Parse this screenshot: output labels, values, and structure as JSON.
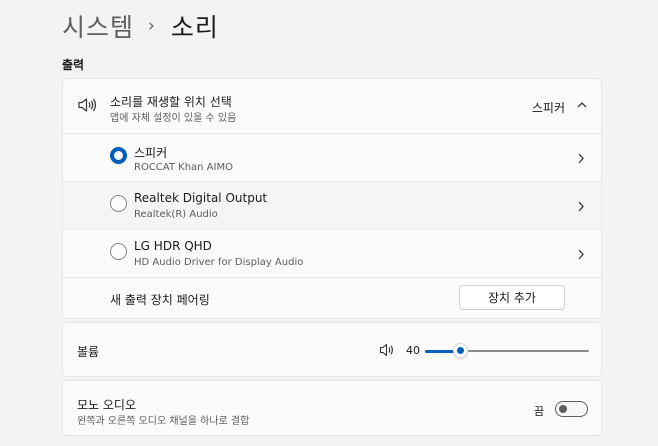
{
  "breadcrumb": {
    "parent": "시스템",
    "separator": "›",
    "current": "소리"
  },
  "output": {
    "section_title": "출력",
    "choose": {
      "title": "소리를 재생할 위치 선택",
      "subtitle": "앱에 자체 설정이 있을 수 있음",
      "selected_value": "스피커",
      "icon": "speaker-icon"
    },
    "devices": [
      {
        "name": "스피커",
        "detail": "ROCCAT Khan AIMO",
        "selected": true
      },
      {
        "name": "Realtek Digital Output",
        "detail": "Realtek(R) Audio",
        "selected": false
      },
      {
        "name": "LG HDR QHD",
        "detail": "HD Audio Driver for Display Audio",
        "selected": false
      }
    ],
    "pair": {
      "label": "새 출력 장치 페어링",
      "button_label": "장치 추가"
    }
  },
  "volume": {
    "label": "볼륨",
    "value": "40",
    "level_percent": 40,
    "icon": "speaker-icon"
  },
  "mono": {
    "title": "모노 오디오",
    "subtitle": "왼쪽과 오른쪽 오디오 채널을 하나로 결합",
    "state_label": "끔",
    "on": false
  },
  "colors": {
    "accent": "#005fb8",
    "background": "#f3f3f3",
    "card": "#fbfbfb"
  }
}
